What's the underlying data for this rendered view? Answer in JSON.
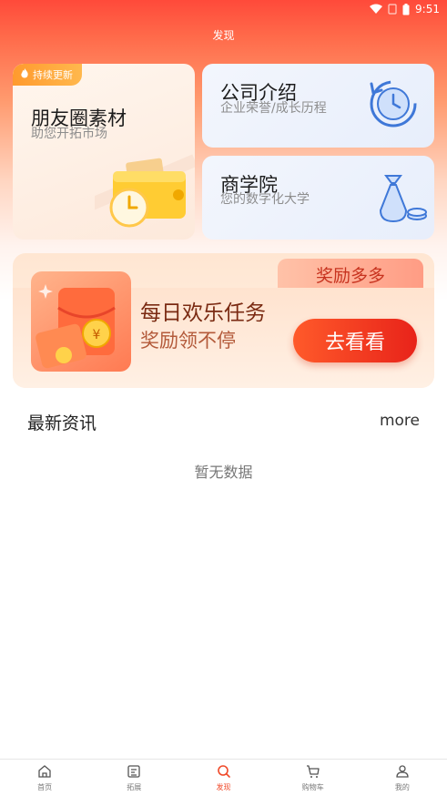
{
  "status_bar": {
    "time": "9:51"
  },
  "header": {
    "title": "发现"
  },
  "cards": {
    "moments": {
      "tag": "持续更新",
      "title": "朋友圈素材",
      "subtitle": "助您开拓市场"
    },
    "company": {
      "title": "公司介绍",
      "subtitle": "企业荣誉/成长历程"
    },
    "academy": {
      "title": "商学院",
      "subtitle": "您的数字化大学"
    }
  },
  "banner": {
    "tab_label": "奖励多多",
    "title": "每日欢乐任务",
    "subtitle": "奖励领不停",
    "button_label": "去看看"
  },
  "news": {
    "title": "最新资讯",
    "more_label": "more",
    "empty_text": "暂无数据"
  },
  "tabbar": {
    "items": [
      {
        "label": "首页",
        "icon": "home-icon"
      },
      {
        "label": "拓展",
        "icon": "expand-icon"
      },
      {
        "label": "发现",
        "icon": "discover-icon"
      },
      {
        "label": "购物车",
        "icon": "cart-icon"
      },
      {
        "label": "我的",
        "icon": "profile-icon"
      }
    ],
    "active_index": 2,
    "active_color": "#f04a2a"
  },
  "colors": {
    "primary": "#ff4a3a",
    "button": "#e8231a"
  }
}
